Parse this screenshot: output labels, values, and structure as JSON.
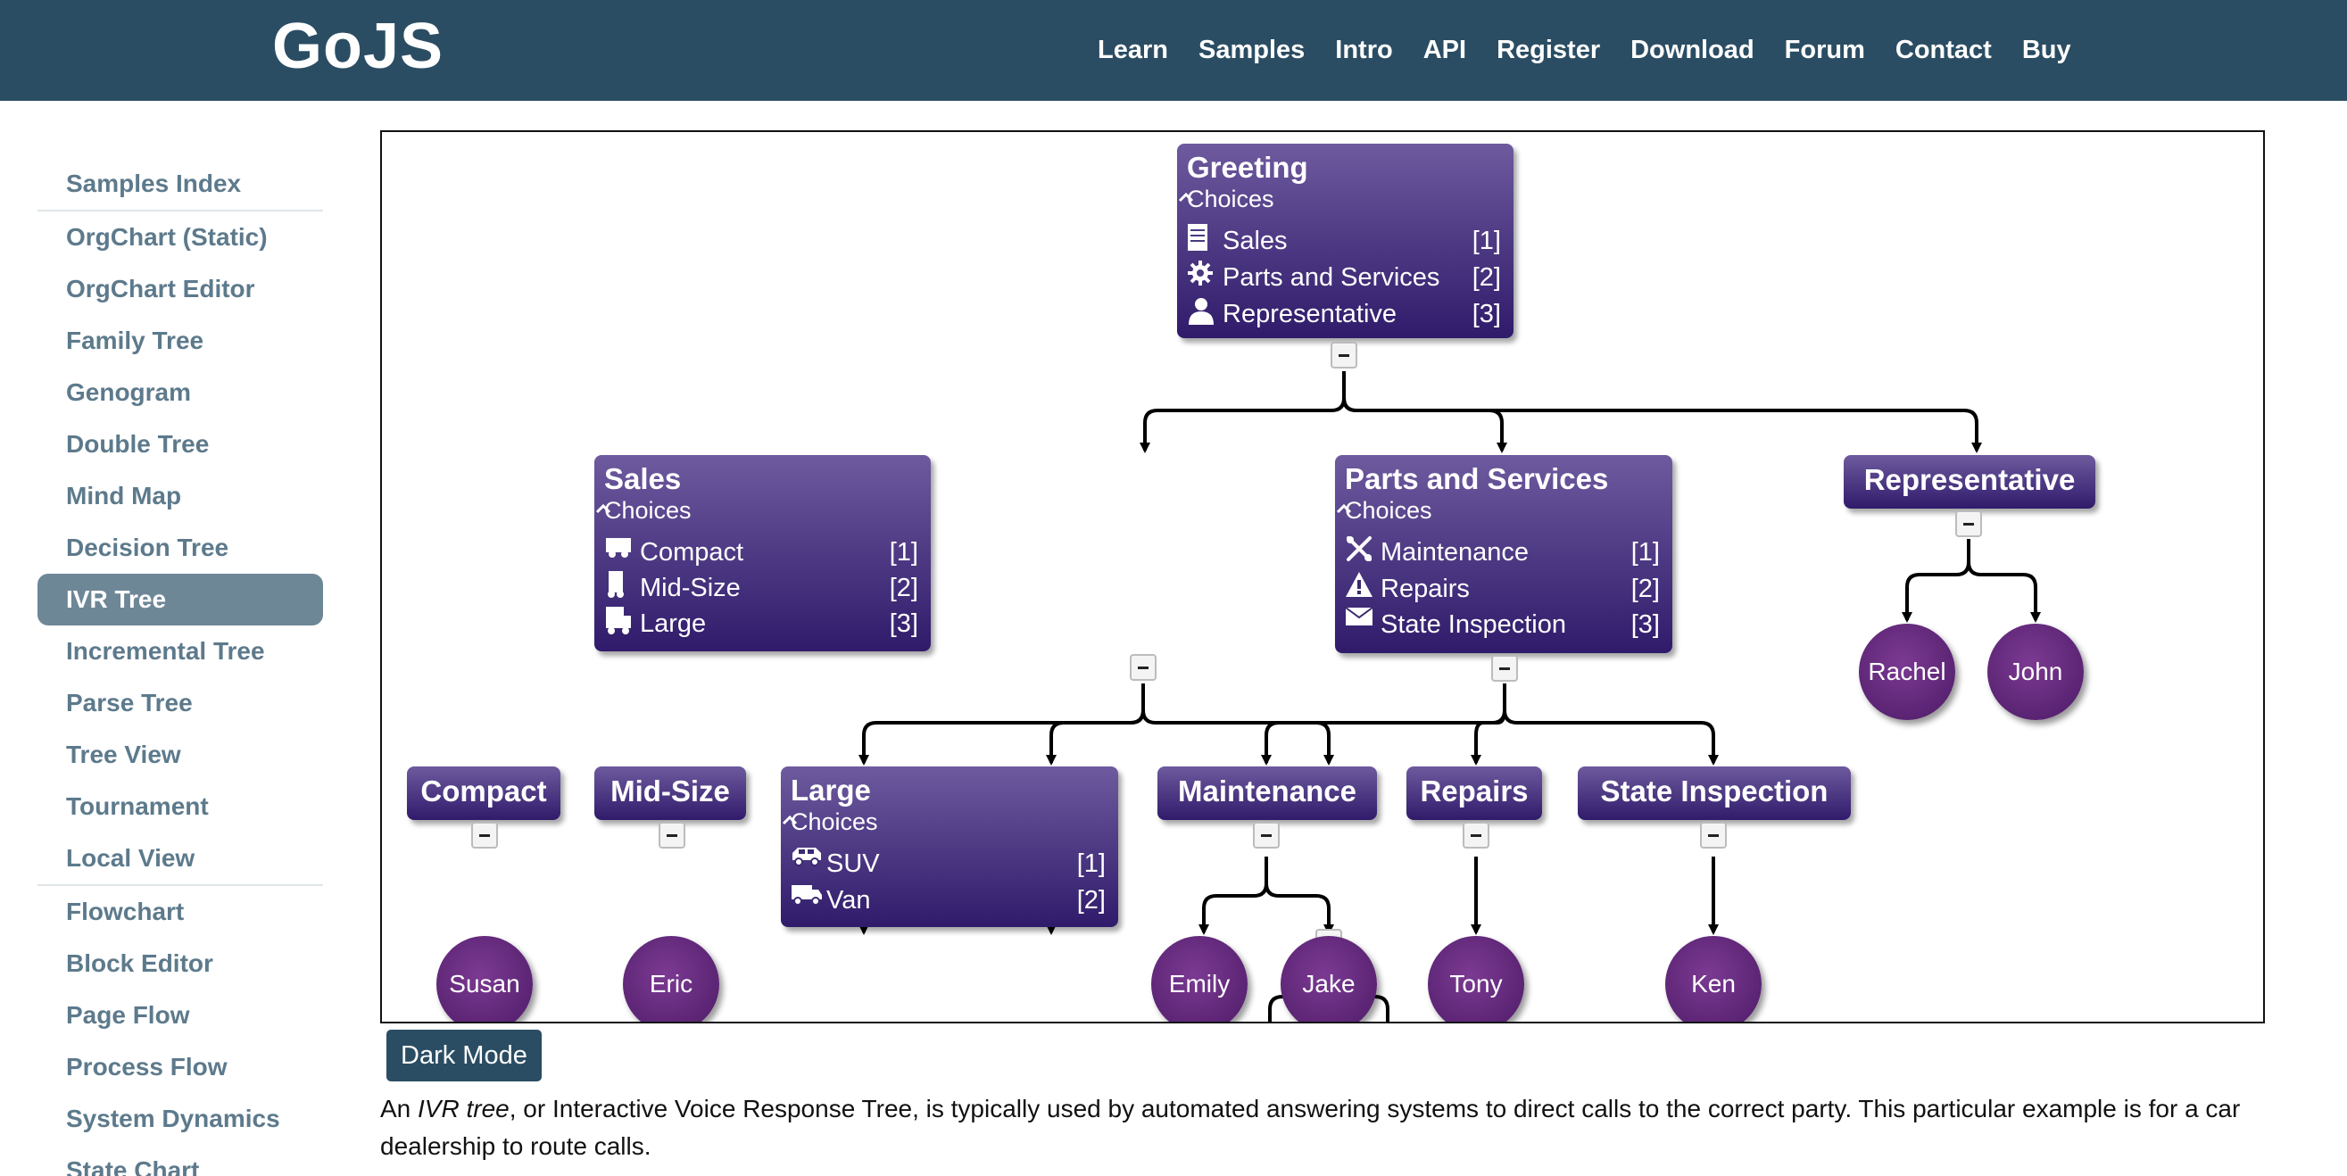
{
  "header": {
    "logo": "GoJS",
    "nav": [
      "Learn",
      "Samples",
      "Intro",
      "API",
      "Register",
      "Download",
      "Forum",
      "Contact",
      "Buy"
    ]
  },
  "sidebar": {
    "group1": [
      "Samples Index"
    ],
    "group2": [
      "OrgChart (Static)",
      "OrgChart Editor",
      "Family Tree",
      "Genogram",
      "Double Tree",
      "Mind Map",
      "Decision Tree",
      "IVR Tree",
      "Incremental Tree",
      "Parse Tree",
      "Tree View",
      "Tournament",
      "Local View"
    ],
    "group3": [
      "Flowchart",
      "Block Editor",
      "Page Flow",
      "Process Flow",
      "System Dynamics",
      "State Chart"
    ],
    "active": "IVR Tree"
  },
  "diagram": {
    "greeting": {
      "title": "Greeting",
      "subtitle": "Choices",
      "choices": [
        {
          "icon": "document-icon",
          "label": "Sales",
          "num": "[1]"
        },
        {
          "icon": "gear-icon",
          "label": "Parts and Services",
          "num": "[2]"
        },
        {
          "icon": "person-icon",
          "label": "Representative",
          "num": "[3]"
        }
      ]
    },
    "sales": {
      "title": "Sales",
      "subtitle": "Choices",
      "choices": [
        {
          "icon": "compact-car-icon",
          "label": "Compact",
          "num": "[1]"
        },
        {
          "icon": "midsize-car-icon",
          "label": "Mid-Size",
          "num": "[2]"
        },
        {
          "icon": "large-car-icon",
          "label": "Large",
          "num": "[3]"
        }
      ]
    },
    "parts": {
      "title": "Parts and Services",
      "subtitle": "Choices",
      "choices": [
        {
          "icon": "wrench-icon",
          "label": "Maintenance",
          "num": "[1]"
        },
        {
          "icon": "warning-icon",
          "label": "Repairs",
          "num": "[2]"
        },
        {
          "icon": "envelope-icon",
          "label": "State Inspection",
          "num": "[3]"
        }
      ]
    },
    "representative": {
      "title": "Representative"
    },
    "compact": {
      "title": "Compact"
    },
    "midsize": {
      "title": "Mid-Size"
    },
    "large": {
      "title": "Large",
      "subtitle": "Choices",
      "choices": [
        {
          "icon": "suv-icon",
          "label": "SUV",
          "num": "[1]"
        },
        {
          "icon": "van-icon",
          "label": "Van",
          "num": "[2]"
        }
      ]
    },
    "maintenance": {
      "title": "Maintenance"
    },
    "repairs": {
      "title": "Repairs"
    },
    "inspection": {
      "title": "State Inspection"
    },
    "people": {
      "rachel": "Rachel",
      "john": "John",
      "susan": "Susan",
      "eric": "Eric",
      "emily": "Emily",
      "jake": "Jake",
      "tony": "Tony",
      "ken": "Ken"
    }
  },
  "dark_mode_label": "Dark Mode",
  "description": {
    "prefix": "An ",
    "em": "IVR tree",
    "suffix": ", or Interactive Voice Response Tree, is typically used by automated answering systems to direct calls to the correct party. This particular example is for a car dealership to route calls."
  },
  "colors": {
    "header": "#2b4d63",
    "node_top": "#6e5a9e",
    "node_bottom": "#2f1b6a",
    "person": "#5a2275",
    "sidebar_active": "#6e8797"
  }
}
